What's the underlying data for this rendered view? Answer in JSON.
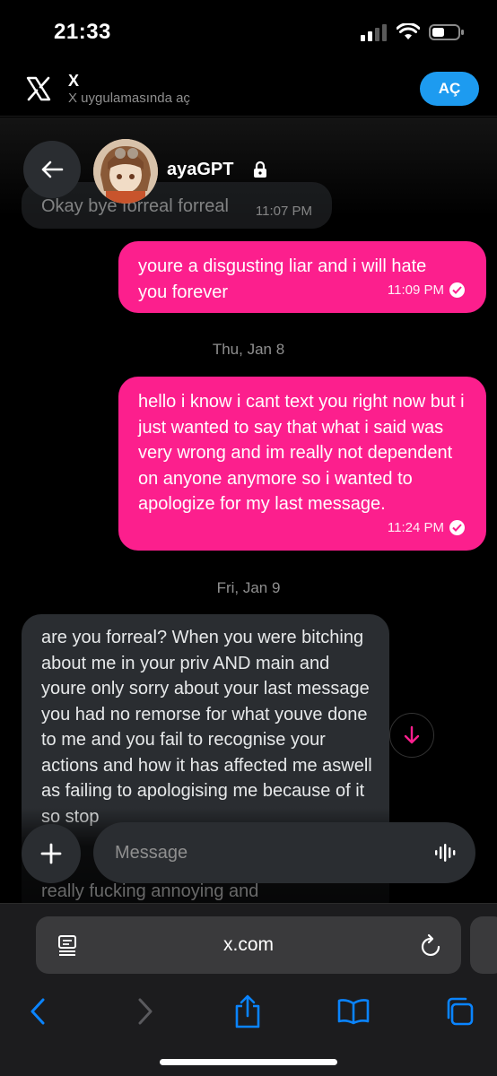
{
  "status_bar": {
    "time": "21:33"
  },
  "banner": {
    "title": "X",
    "subtitle": "X uygulamasında aç",
    "open_label": "AÇ"
  },
  "chat": {
    "contact_name": "ayaGPT",
    "messages": [
      {
        "side": "received",
        "text": "Okay bye forreal forreal",
        "time": "11:07 PM"
      },
      {
        "side": "sent",
        "text": "youre a disgusting liar and i will hate you forever",
        "time": "11:09 PM"
      },
      {
        "side": "sent",
        "text": "hello i know i cant text you right now but i just wanted to say that what i said was very wrong and im really not dependent on anyone anymore so i wanted to apologize for my last message.",
        "time": "11:24 PM"
      },
      {
        "side": "received",
        "text": "are you forreal? When you were bitching about me in your priv AND main and youre only sorry about your last message you had no remorse for what youve done to me and you fail to recognise your actions and how it has affected me aswell as failing to apologising me because of it so stop",
        "time": ""
      }
    ],
    "dividers": [
      "Thu, Jan 8",
      "Fri, Jan 9"
    ],
    "partial_text": "really fucking annoying and",
    "compose_placeholder": "Message"
  },
  "browser": {
    "url": "x.com"
  },
  "colors": {
    "sent_bubble": "#fc1f8d",
    "received_bubble": "#2a2d31",
    "accent": "#1d9bf0",
    "scroll_arrow": "#fc1f8d"
  }
}
